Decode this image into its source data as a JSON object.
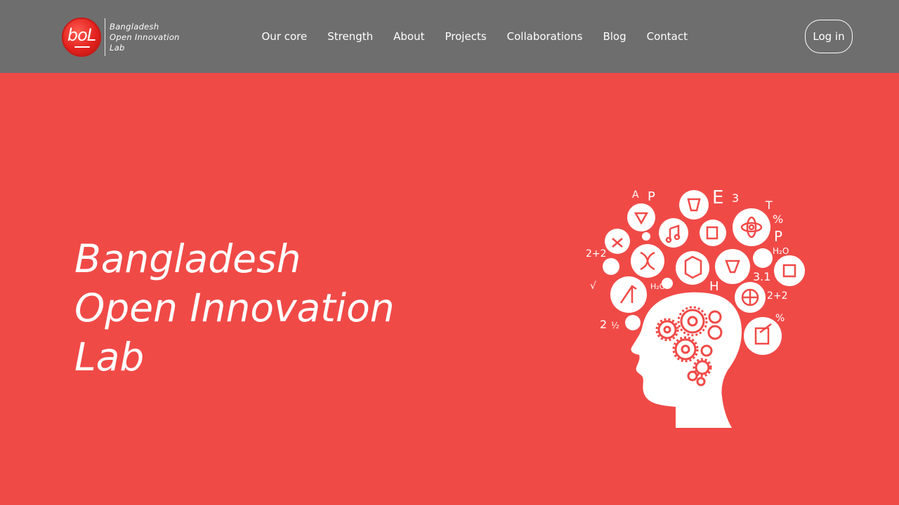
{
  "logo": {
    "badge_text": "boL",
    "lines": [
      "Bangladesh",
      "Open Innovation",
      "Lab"
    ]
  },
  "nav": {
    "items": [
      "Our core",
      "Strength",
      "About",
      "Projects",
      "Collaborations",
      "Blog",
      "Contact"
    ],
    "login_label": "Log in"
  },
  "hero": {
    "title_lines": [
      "Bangladesh",
      "Open Innovation",
      "Lab"
    ]
  },
  "illustration": {
    "icon": "head-with-gears-and-science-icons",
    "glyphs": [
      "2+2",
      "2+2",
      "A",
      "P",
      "E",
      "3",
      "T",
      "%",
      "P",
      "H₂O",
      "H₂O",
      "H",
      "2",
      "½",
      "%",
      "3.1",
      "√"
    ]
  },
  "colors": {
    "header_bg": "#6e6e6e",
    "hero_bg": "#f04a47",
    "text": "#ffffff",
    "logo_red": "#e3231f"
  }
}
